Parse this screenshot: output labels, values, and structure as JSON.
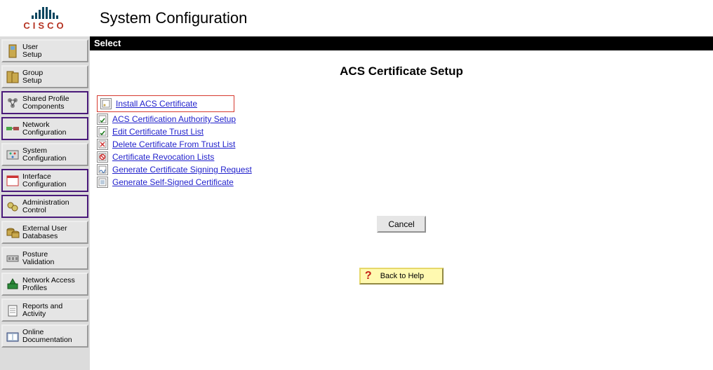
{
  "logo_text": "CISCO",
  "title": "System Configuration",
  "select_bar": "Select",
  "sidebar": {
    "items": [
      {
        "label": "User\nSetup",
        "icon": "user",
        "active": false
      },
      {
        "label": "Group\nSetup",
        "icon": "group",
        "active": false
      },
      {
        "label": "Shared Profile\nComponents",
        "icon": "shared",
        "active": true
      },
      {
        "label": "Network\nConfiguration",
        "icon": "network",
        "active": true
      },
      {
        "label": "System\nConfiguration",
        "icon": "system",
        "active": false
      },
      {
        "label": "Interface\nConfiguration",
        "icon": "interface",
        "active": true
      },
      {
        "label": "Administration\nControl",
        "icon": "admin",
        "active": true
      },
      {
        "label": "External User\nDatabases",
        "icon": "db",
        "active": false
      },
      {
        "label": "Posture\nValidation",
        "icon": "posture",
        "active": false
      },
      {
        "label": "Network Access\nProfiles",
        "icon": "profiles",
        "active": false
      },
      {
        "label": "Reports and\nActivity",
        "icon": "reports",
        "active": false
      },
      {
        "label": "Online\nDocumentation",
        "icon": "docs",
        "active": false
      }
    ]
  },
  "content": {
    "title": "ACS Certificate Setup",
    "links": [
      {
        "label": "Install ACS Certificate",
        "icon": "cert",
        "highlight": true
      },
      {
        "label": "ACS Certification Authority Setup",
        "icon": "cert-a",
        "highlight": false
      },
      {
        "label": "Edit Certificate Trust List",
        "icon": "edit",
        "highlight": false
      },
      {
        "label": "Delete Certificate From Trust List",
        "icon": "delete",
        "highlight": false
      },
      {
        "label": "Certificate Revocation Lists",
        "icon": "revoke",
        "highlight": false
      },
      {
        "label": "Generate Certificate Signing Request",
        "icon": "sign",
        "highlight": false
      },
      {
        "label": "Generate Self-Signed Certificate",
        "icon": "self",
        "highlight": false
      }
    ],
    "cancel_label": "Cancel",
    "help_label": "Back to Help"
  }
}
